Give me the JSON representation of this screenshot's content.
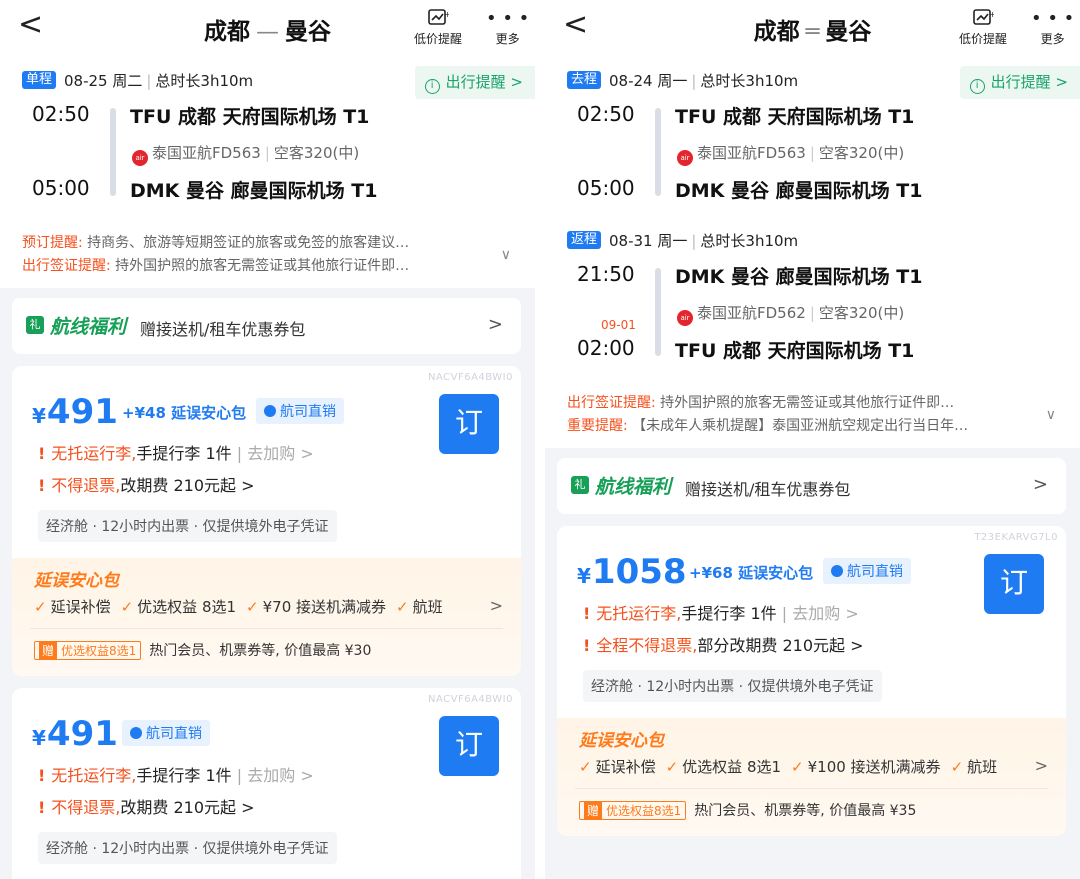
{
  "left": {
    "nav": {
      "back": "<",
      "origin": "成都",
      "dest": "曼谷",
      "alert_label": "低价提醒",
      "more_label": "更多"
    },
    "segments": [
      {
        "tag": "单程",
        "date": "08-25 周二",
        "duration": "总时长3h10m",
        "reminder": "出行提醒",
        "dep_time": "02:50",
        "dep_airport": "TFU  成都 天府国际机场 T1",
        "airline": "泰国亚航FD563",
        "aircraft": "空客320(中)",
        "arr_time": "05:00",
        "arr_airport": "DMK  曼谷 廊曼国际机场 T1",
        "arr_date": ""
      }
    ],
    "notes": [
      {
        "k": "预订提醒:",
        "v": "持商务、旅游等短期签证的旅客或免签的旅客建议…"
      },
      {
        "k": "出行签证提醒:",
        "v": "持外国护照的旅客无需签证或其他旅行证件即…"
      }
    ],
    "benefit": {
      "title": "航线福利",
      "desc": "赠接送机/租车优惠券包"
    },
    "cards": [
      {
        "code": "NACVF6A4BWI0",
        "price": "491",
        "addon": "+¥48 延误安心包",
        "direct": "航司直销",
        "book": "订",
        "bag": "无托运行李,",
        "bag_rest": "手提行李 1件",
        "bag_buy": "| 去加购 >",
        "refund": "不得退票,",
        "refund_rest": "改期费 210元起 >",
        "cabin": "经济舱 · 12小时内出票 · 仅提供境外电子凭证",
        "ins_title": "延误安心包",
        "ins_items": [
          "延误补偿",
          "优选权益 8选1",
          "¥70 接送机满减券",
          "航班"
        ],
        "gift_badge": "优选权益8选1",
        "gift_text": "热门会员、机票券等, 价值最高 ¥30"
      },
      {
        "code": "NACVF6A4BWI0",
        "price": "491",
        "addon": "",
        "direct": "航司直销",
        "book": "订",
        "bag": "无托运行李,",
        "bag_rest": "手提行李 1件",
        "bag_buy": "| 去加购 >",
        "refund": "不得退票,",
        "refund_rest": "改期费 210元起 >",
        "cabin": "经济舱 · 12小时内出票 · 仅提供境外电子凭证"
      }
    ]
  },
  "right": {
    "nav": {
      "back": "<",
      "origin": "成都",
      "dest": "曼谷",
      "alert_label": "低价提醒",
      "more_label": "更多"
    },
    "segments": [
      {
        "tag": "去程",
        "date": "08-24 周一",
        "duration": "总时长3h10m",
        "reminder": "出行提醒",
        "dep_time": "02:50",
        "dep_airport": "TFU  成都 天府国际机场 T1",
        "airline": "泰国亚航FD563",
        "aircraft": "空客320(中)",
        "arr_time": "05:00",
        "arr_airport": "DMK  曼谷 廊曼国际机场 T1",
        "arr_date": ""
      },
      {
        "tag": "返程",
        "date": "08-31 周一",
        "duration": "总时长3h10m",
        "reminder": "",
        "dep_time": "21:50",
        "dep_airport": "DMK  曼谷 廊曼国际机场 T1",
        "airline": "泰国亚航FD562",
        "aircraft": "空客320(中)",
        "arr_time": "02:00",
        "arr_airport": "TFU  成都 天府国际机场 T1",
        "arr_date": "09-01"
      }
    ],
    "notes": [
      {
        "k": "出行签证提醒:",
        "v": "持外国护照的旅客无需签证或其他旅行证件即…"
      },
      {
        "k": "重要提醒:",
        "v": "【未成年人乘机提醒】泰国亚洲航空规定出行当日年…"
      }
    ],
    "benefit": {
      "title": "航线福利",
      "desc": "赠接送机/租车优惠券包"
    },
    "cards": [
      {
        "code": "T23EKARVG7L0",
        "price": "1058",
        "addon": "+¥68 延误安心包",
        "direct": "航司直销",
        "book": "订",
        "bag": "无托运行李,",
        "bag_rest": "手提行李 1件",
        "bag_buy": "| 去加购 >",
        "refund": "全程不得退票,",
        "refund_rest": "部分改期费 210元起 >",
        "cabin": "经济舱 · 12小时内出票 · 仅提供境外电子凭证",
        "ins_title": "延误安心包",
        "ins_items": [
          "延误补偿",
          "优选权益 8选1",
          "¥100 接送机满减券",
          "航班"
        ],
        "gift_badge": "优选权益8选1",
        "gift_text": "热门会员、机票券等, 价值最高 ¥35"
      }
    ]
  },
  "colors": {
    "brand_blue": "#1f7bf2",
    "warn_orange": "#f5511e",
    "benefit_green": "#18a058",
    "insurance_orange": "#ff7a1a"
  }
}
